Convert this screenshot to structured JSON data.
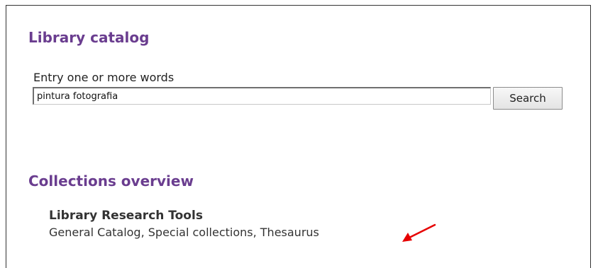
{
  "catalog": {
    "heading": "Library catalog",
    "field_label": "Entry one or more words",
    "search_value": "pintura fotografia",
    "search_button_label": "Search"
  },
  "collections": {
    "heading": "Collections overview",
    "title": "Library Research Tools",
    "links": [
      "General Catalog",
      "Special collections",
      "Thesaurus"
    ],
    "separator": ", "
  },
  "annotation": {
    "arrow_color": "#e60000",
    "icon": "red-arrow-icon"
  },
  "colors": {
    "heading": "#6a3d8f",
    "text": "#333333"
  }
}
